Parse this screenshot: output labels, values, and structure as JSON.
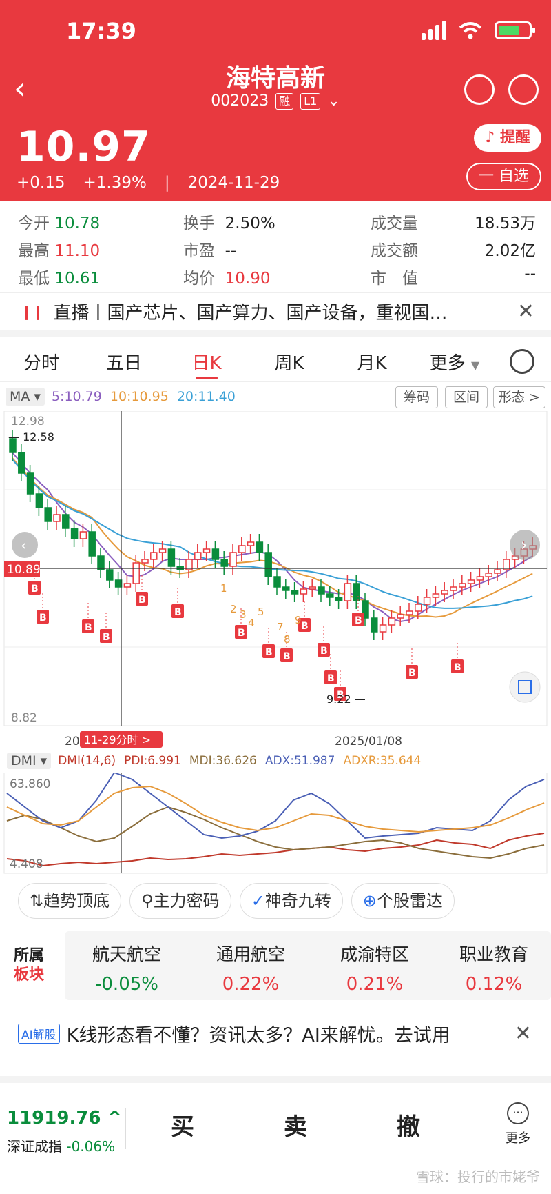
{
  "status": {
    "time": "17:39"
  },
  "header": {
    "stock_name": "海特高新",
    "code": "002023",
    "tag_margin": "融",
    "tag_level": "L1",
    "price": "10.97",
    "change": "+0.15",
    "change_pct": "+1.39%",
    "date": "2024-11-29",
    "alert_label": "提醒",
    "watch_label": "一 自选"
  },
  "quote": {
    "open": {
      "label": "今开",
      "value": "10.78"
    },
    "high": {
      "label": "最高",
      "value": "11.10"
    },
    "low": {
      "label": "最低",
      "value": "10.61"
    },
    "turnover": {
      "label": "换手",
      "value": "2.50%"
    },
    "pe": {
      "label": "市盈",
      "value": "--"
    },
    "avg": {
      "label": "均价",
      "value": "10.90"
    },
    "volume": {
      "label": "成交量",
      "value": "18.53万"
    },
    "amount": {
      "label": "成交额",
      "value": "2.02亿"
    },
    "mktcap": {
      "label": "市　值",
      "value": "--"
    }
  },
  "notice": {
    "text": "直播丨国产芯片、国产算力、国产设备，重视国…"
  },
  "tabs": [
    "分时",
    "五日",
    "日K",
    "周K",
    "月K",
    "更多"
  ],
  "active_tab": "日K",
  "ma": {
    "selector": "MA",
    "ma5": "5:10.79",
    "ma10": "10:10.95",
    "ma20": "20:11.40",
    "btn_chips": "筹码",
    "btn_range": "区间",
    "btn_shape": "形态 >"
  },
  "kline": {
    "y_top": "12.98",
    "y_bottom": "8.82",
    "y_cursor": "10.89",
    "max_label": "12.58",
    "min_label": "9.22",
    "x_date": "2025/01/08",
    "x_left": "20",
    "cursor_tag": "11-29分时 >",
    "buy_marker": "B",
    "nine_labels": [
      "1",
      "2",
      "3",
      "4",
      "5",
      "7",
      "8",
      "9"
    ]
  },
  "dmi": {
    "selector": "DMI",
    "params": "DMI(14,6)",
    "pdi": "PDI:6.991",
    "mdi": "MDI:36.626",
    "adx": "ADX:51.987",
    "adxr": "ADXR:35.644",
    "y_top": "63.860",
    "y_bottom": "4.408"
  },
  "tools": [
    "趋势顶底",
    "主力密码",
    "神奇九转",
    "个股雷达"
  ],
  "sector": {
    "label1": "所属",
    "label2": "板块",
    "items": [
      {
        "name": "航天航空",
        "value": "-0.05%"
      },
      {
        "name": "通用航空",
        "value": "0.22%"
      },
      {
        "name": "成渝特区",
        "value": "0.21%"
      },
      {
        "name": "职业教育",
        "value": "0.12%"
      }
    ]
  },
  "ai": {
    "tag": "AI解股",
    "text": "K线形态看不懂？资讯太多？AI来解忧。去试用"
  },
  "bottom": {
    "index_value": "11919.76 ^",
    "index_name": "深证成指",
    "index_change": "-0.06%",
    "buy": "买",
    "sell": "卖",
    "cancel": "撤",
    "more": "更多"
  },
  "watermark": "雪球：投行的市姥爷",
  "colors": {
    "header_red": "#e8393f",
    "up": "#e8393f",
    "down": "#0a8d3c",
    "ma5": "#8b5fbf",
    "ma10": "#e69a3c",
    "ma20": "#3aa0d6"
  }
}
